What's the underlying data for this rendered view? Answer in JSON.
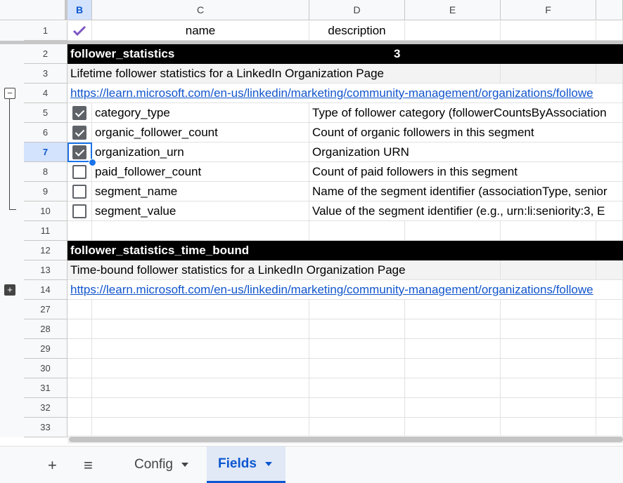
{
  "column_headers": [
    "B",
    "C",
    "D",
    "E",
    "F"
  ],
  "header_row": {
    "row_number": "1",
    "name": "name",
    "description": "description"
  },
  "group_toggle": {
    "collapse": "−",
    "expand": "+"
  },
  "rows": [
    {
      "n": "2",
      "type": "section",
      "title": "follower_statistics",
      "count": "3"
    },
    {
      "n": "3",
      "type": "desc",
      "text": "Lifetime follower statistics for a LinkedIn Organization Page"
    },
    {
      "n": "4",
      "type": "link",
      "text": "https://learn.microsoft.com/en-us/linkedin/marketing/community-management/organizations/followe"
    },
    {
      "n": "5",
      "type": "field",
      "checked": true,
      "name": "category_type",
      "description": "Type of follower category (followerCountsByAssociation"
    },
    {
      "n": "6",
      "type": "field",
      "checked": true,
      "name": "organic_follower_count",
      "description": "Count of organic followers in this segment"
    },
    {
      "n": "7",
      "type": "field",
      "checked": true,
      "name": "organization_urn",
      "description": "Organization URN"
    },
    {
      "n": "8",
      "type": "field",
      "checked": false,
      "name": "paid_follower_count",
      "description": "Count of paid followers in this segment"
    },
    {
      "n": "9",
      "type": "field",
      "checked": false,
      "name": "segment_name",
      "description": "Name of the segment identifier (associationType, senior"
    },
    {
      "n": "10",
      "type": "field",
      "checked": false,
      "name": "segment_value",
      "description": "Value of the segment identifier (e.g., urn:li:seniority:3, E"
    },
    {
      "n": "11",
      "type": "empty"
    },
    {
      "n": "12",
      "type": "section",
      "title": "follower_statistics_time_bound",
      "count": ""
    },
    {
      "n": "13",
      "type": "desc",
      "text": "Time-bound follower statistics for a LinkedIn Organization Page"
    },
    {
      "n": "14",
      "type": "link",
      "text": "https://learn.microsoft.com/en-us/linkedin/marketing/community-management/organizations/followe"
    },
    {
      "n": "27",
      "type": "empty"
    },
    {
      "n": "28",
      "type": "empty"
    },
    {
      "n": "29",
      "type": "empty"
    },
    {
      "n": "30",
      "type": "empty"
    },
    {
      "n": "31",
      "type": "empty"
    },
    {
      "n": "32",
      "type": "empty"
    },
    {
      "n": "33",
      "type": "empty"
    }
  ],
  "sheet_tabs": {
    "add_icon": "+",
    "menu_icon": "≡",
    "tabs": [
      {
        "label": "Config",
        "active": false
      },
      {
        "label": "Fields",
        "active": true
      }
    ]
  },
  "colors": {
    "accent": "#0b57d0",
    "section_bg": "#000000",
    "link": "#1155cc"
  }
}
